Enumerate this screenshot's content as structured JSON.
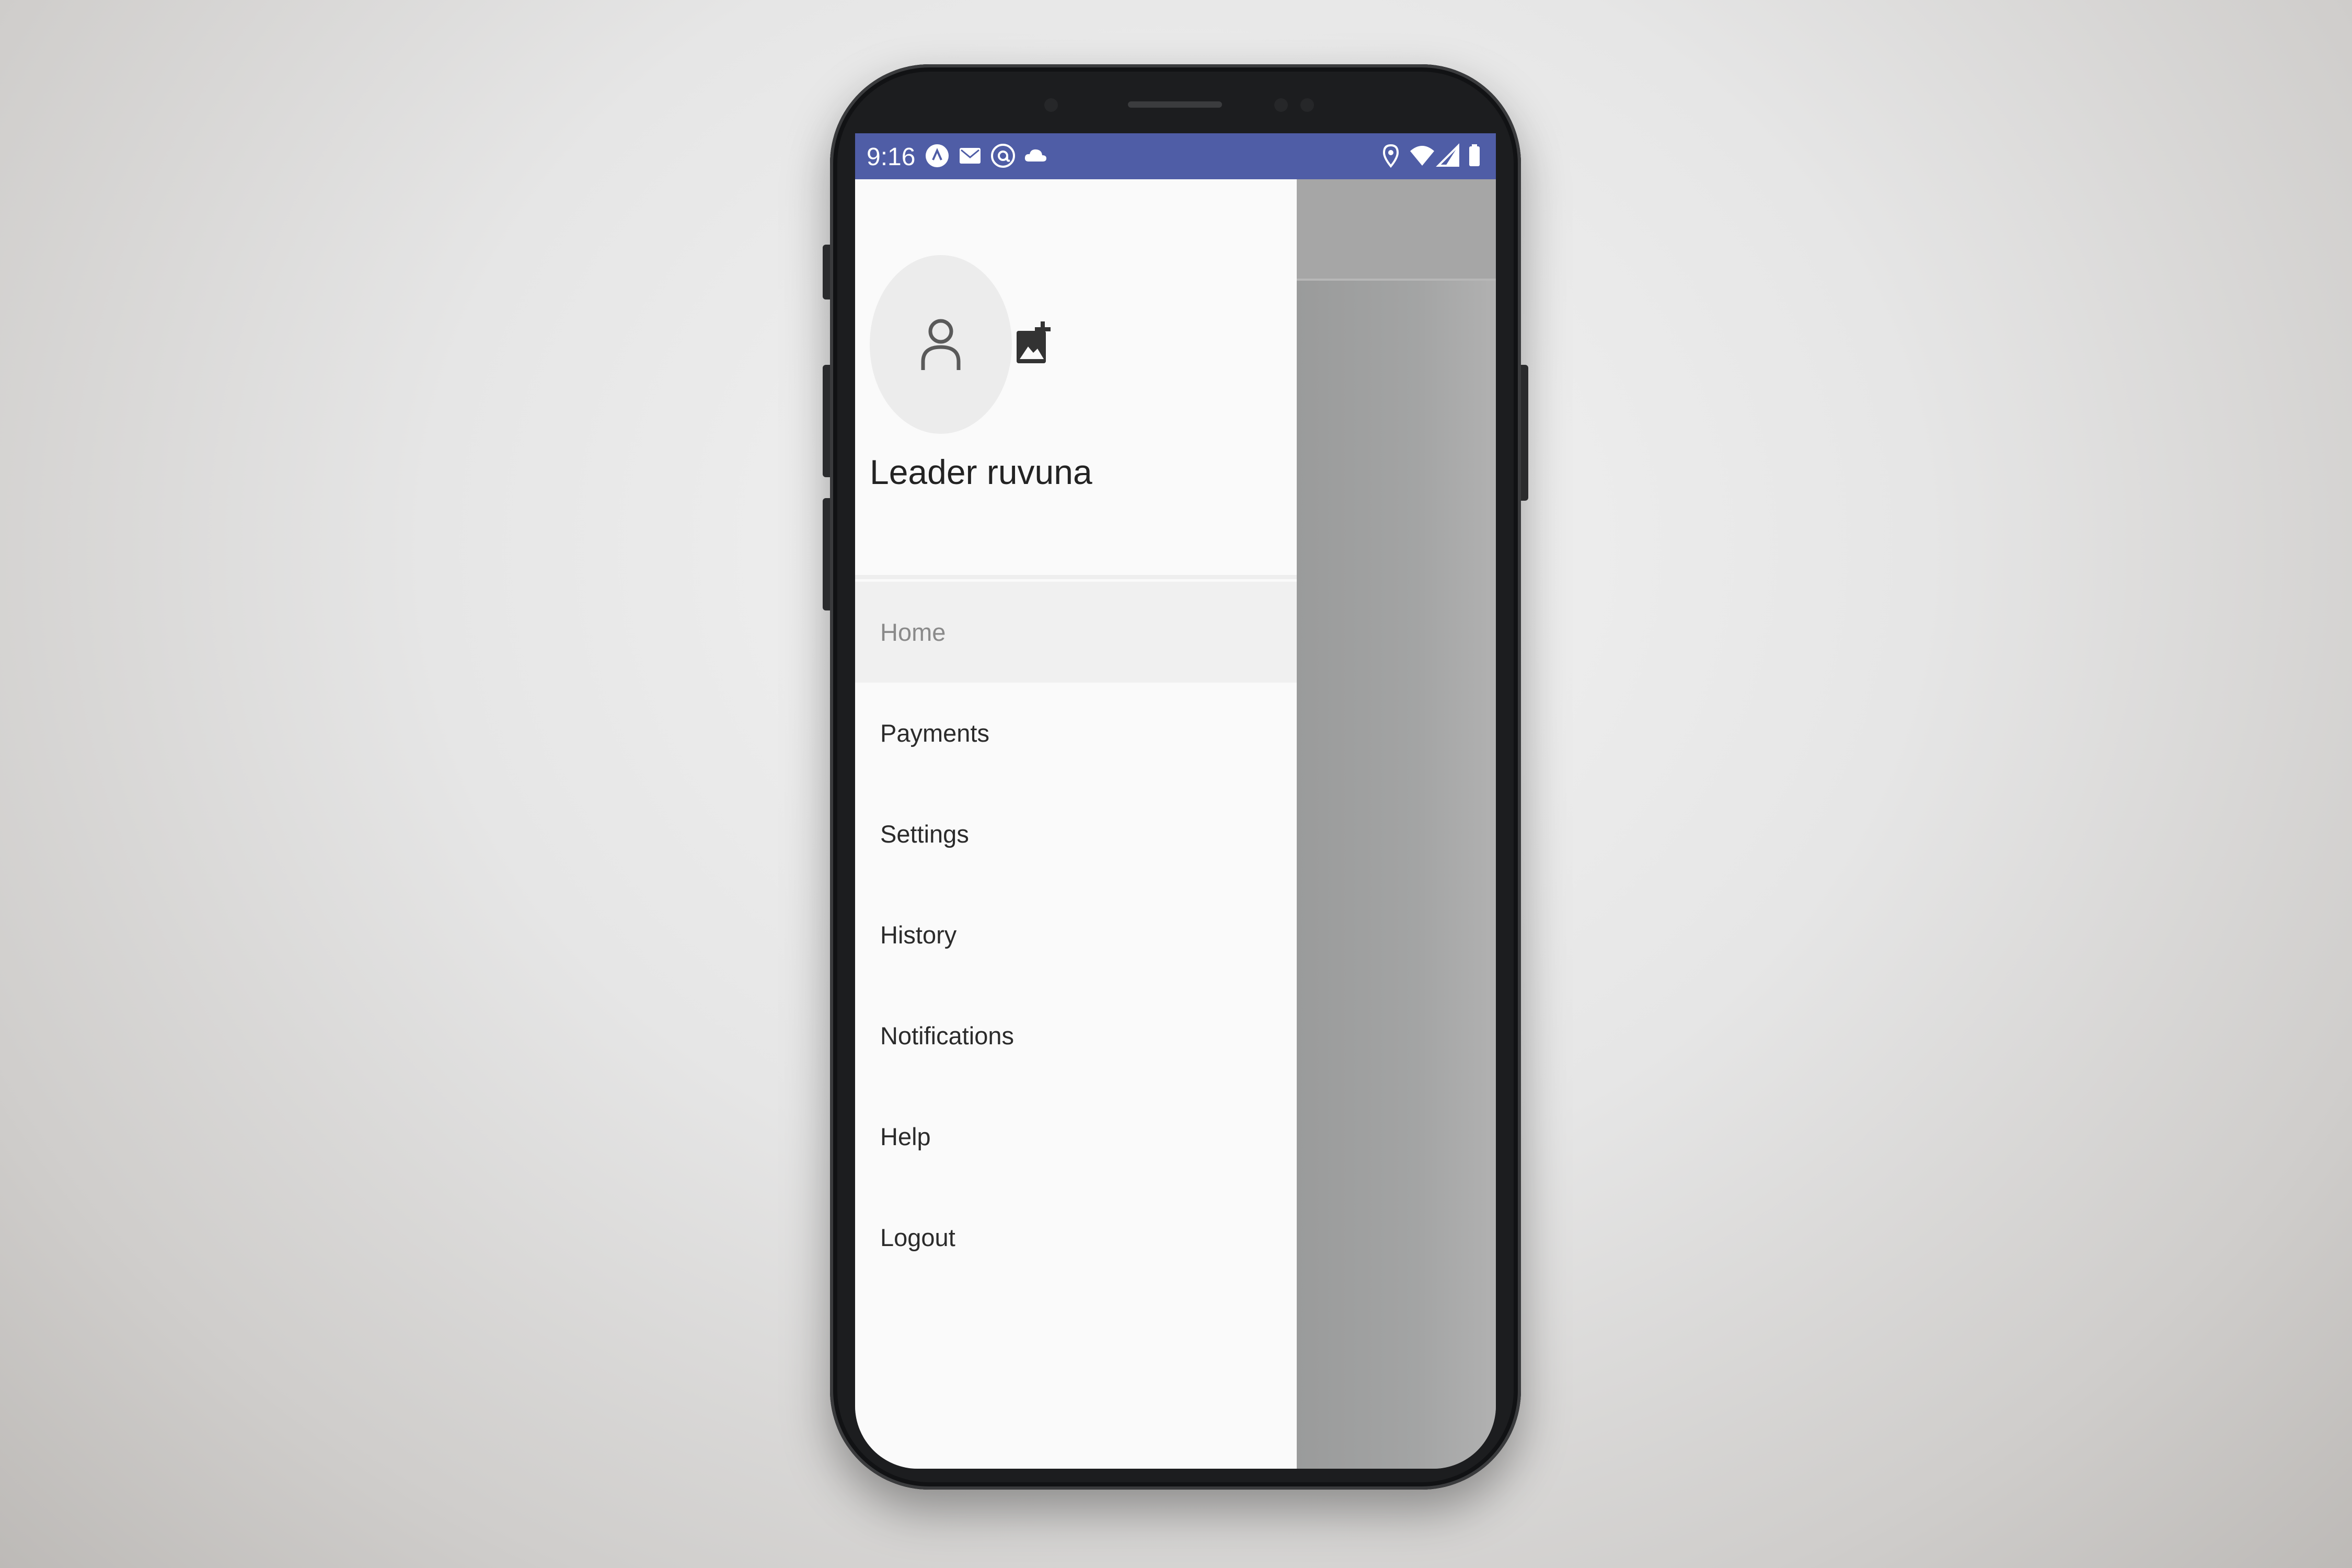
{
  "status_bar": {
    "time": "9:16",
    "color": "#4f5da6",
    "left_icons": [
      "app-circle-icon",
      "mail-icon",
      "at-sign-icon",
      "cloud-icon"
    ],
    "right_icons": [
      "location-icon",
      "wifi-icon",
      "signal-icon",
      "battery-icon"
    ]
  },
  "drawer": {
    "avatar_icon": "person-outline-icon",
    "add_photo_icon": "add-photo-icon",
    "user_name": "Leader ruvuna",
    "items": [
      {
        "label": "Home",
        "active": true
      },
      {
        "label": "Payments",
        "active": false
      },
      {
        "label": "Settings",
        "active": false
      },
      {
        "label": "History",
        "active": false
      },
      {
        "label": "Notifications",
        "active": false
      },
      {
        "label": "Help",
        "active": false
      },
      {
        "label": "Logout",
        "active": false
      }
    ]
  },
  "colors": {
    "drawer_bg": "#fafafa",
    "scrim": "#9a9b9c",
    "active_item_bg": "#f0f0f0",
    "active_item_text": "#8a8a8a",
    "item_text": "#2b2b2b"
  }
}
